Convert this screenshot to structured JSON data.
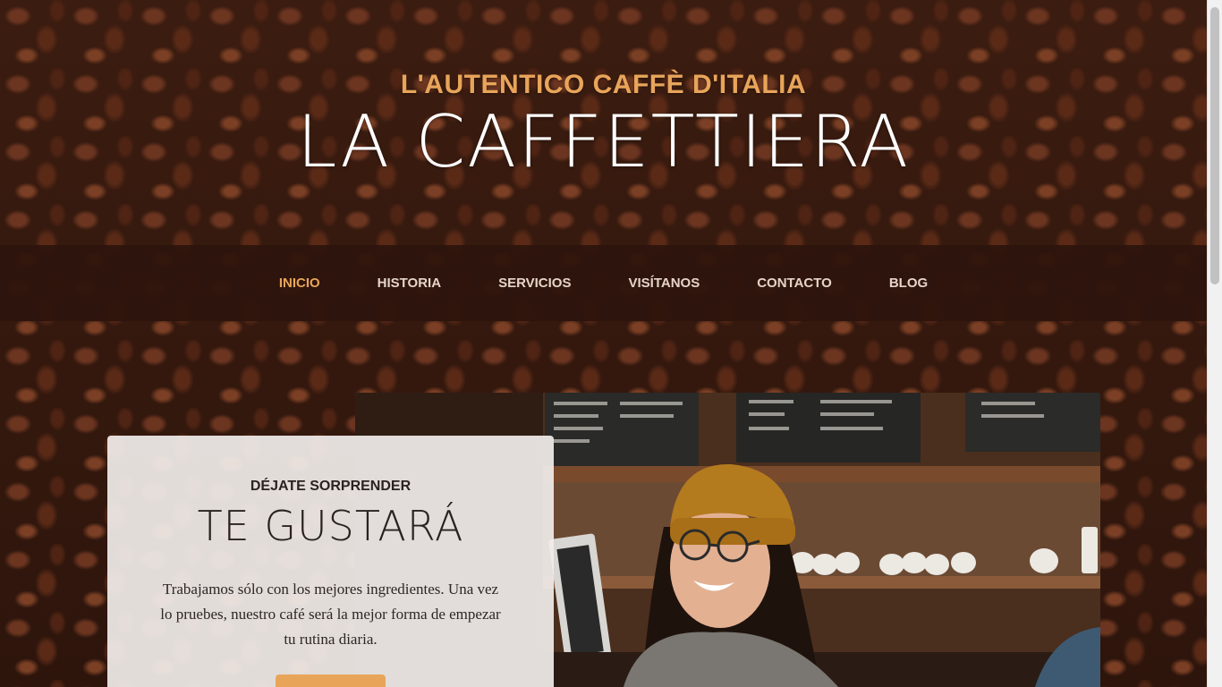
{
  "header": {
    "subheading": "L'AUTENTICO CAFFÈ D'ITALIA",
    "heading": "LA CAFFETTIERA"
  },
  "nav": {
    "items": [
      {
        "label": "INICIO",
        "active": true
      },
      {
        "label": "HISTORIA",
        "active": false
      },
      {
        "label": "SERVICIOS",
        "active": false
      },
      {
        "label": "VISÍTANOS",
        "active": false
      },
      {
        "label": "CONTACTO",
        "active": false
      },
      {
        "label": "BLOG",
        "active": false
      }
    ]
  },
  "intro": {
    "subheading": "DÉJATE SORPRENDER",
    "heading": "TE GUSTARÁ",
    "text": "Trabajamos sólo con los mejores ingredientes. Una vez lo pruebes, nuestro café será la mejor forma de empezar tu rutina diaria.",
    "photo_icon": "barista-photo"
  },
  "colors": {
    "accent": "#e8a55a",
    "nav_background": "#2c140c",
    "card_background": "#f0ecea"
  }
}
